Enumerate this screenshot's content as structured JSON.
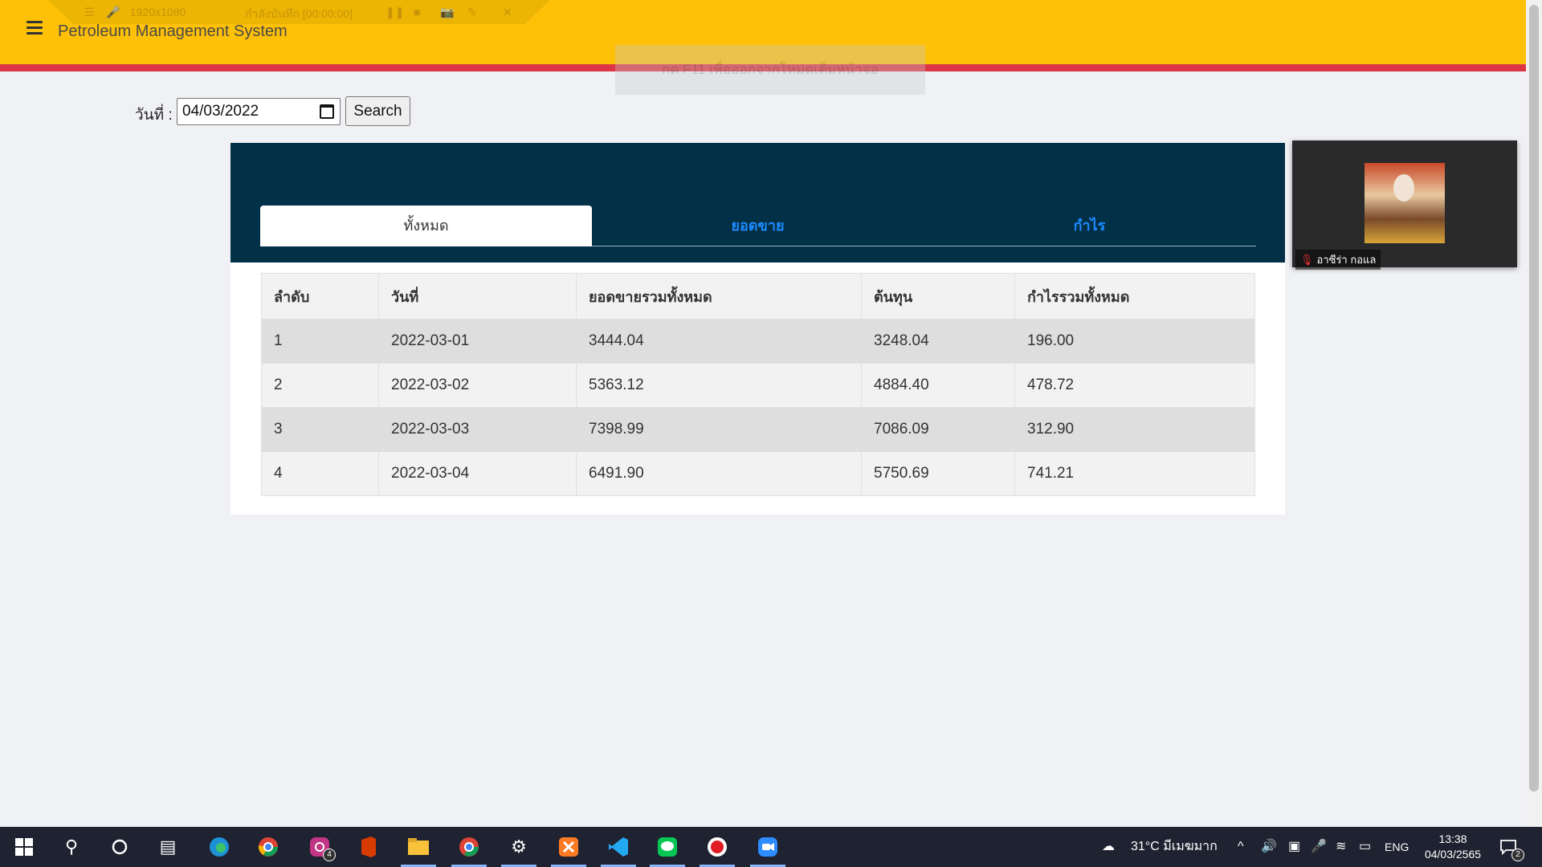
{
  "header": {
    "title": "Petroleum Management System"
  },
  "recorder": {
    "resolution": "1920x1080",
    "status": "กำลังบันทึก [00:00:00]",
    "hint": "กด  F11  เพื่อออกจากโหมดเต็มหน้าจอ"
  },
  "search": {
    "label": "วันที่ :",
    "date_value": "04/03/2022",
    "button_label": "Search"
  },
  "tabs": [
    {
      "label": "ทั้งหมด",
      "active": true
    },
    {
      "label": "ยอดขาย",
      "active": false
    },
    {
      "label": "กำไร",
      "active": false
    }
  ],
  "table": {
    "headers": [
      "ลำดับ",
      "วันที่",
      "ยอดขายรวมทั้งหมด",
      "ต้นทุน",
      "กำไรรวมทั้งหมด"
    ],
    "rows": [
      [
        "1",
        "2022-03-01",
        "3444.04",
        "3248.04",
        "196.00"
      ],
      [
        "2",
        "2022-03-02",
        "5363.12",
        "4884.40",
        "478.72"
      ],
      [
        "3",
        "2022-03-03",
        "7398.99",
        "7086.09",
        "312.90"
      ],
      [
        "4",
        "2022-03-04",
        "6491.90",
        "5750.69",
        "741.21"
      ]
    ]
  },
  "video": {
    "participant_name": "อาซีร่า กอแล"
  },
  "taskbar": {
    "weather": "31°C  มีเมฆมาก",
    "language": "ENG",
    "time": "13:38",
    "date": "04/03/2565",
    "instagram_badge": "4",
    "notification_badge": "2"
  },
  "colors": {
    "header": "#ffc107",
    "accent_line": "#dc3545",
    "card_head": "#023047",
    "tab_link": "#1e8bff"
  }
}
